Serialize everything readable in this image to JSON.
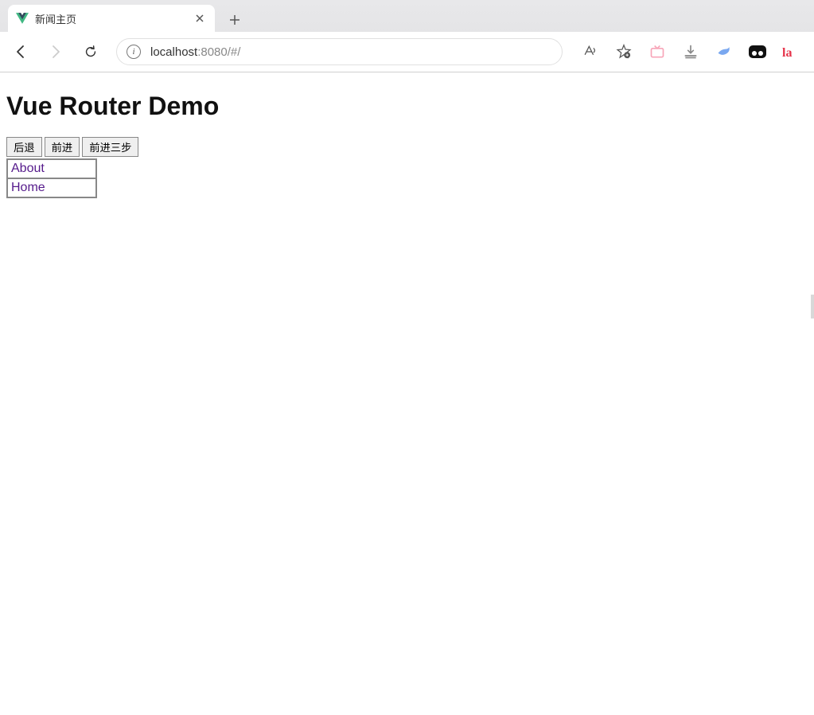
{
  "browser": {
    "tab": {
      "title": "新闻主页"
    },
    "url": {
      "host": "localhost",
      "rest": ":8080/#/"
    }
  },
  "page": {
    "heading": "Vue Router Demo",
    "buttons": {
      "back": "后退",
      "forward": "前进",
      "forward3": "前进三步"
    },
    "links": {
      "about": "About",
      "home": "Home"
    }
  }
}
